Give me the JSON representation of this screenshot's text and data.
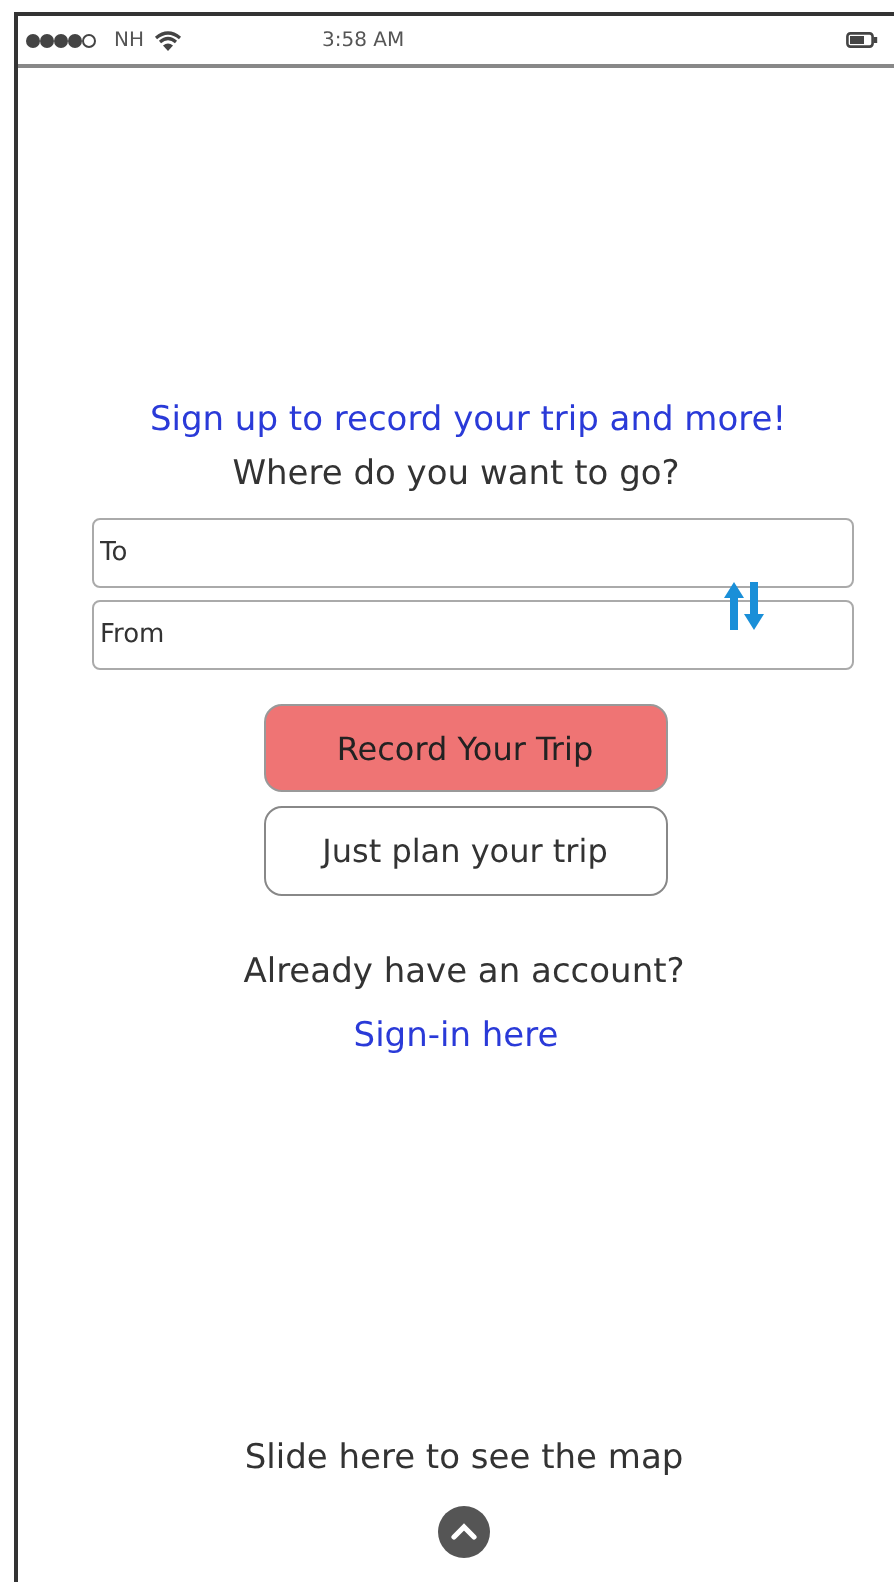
{
  "status_bar": {
    "carrier": "NH",
    "time": "3:58 AM"
  },
  "signup_prompt": "Sign up to record your trip and more!",
  "question": "Where do you want to go?",
  "fields": [
    {
      "placeholder": "To"
    },
    {
      "placeholder": "From"
    }
  ],
  "buttons": [
    {
      "label": "Record Your Trip",
      "kind": "primary"
    },
    {
      "label": "Just plan your trip",
      "kind": "secondary"
    }
  ],
  "account_prompt": "Already have an account?",
  "signin_link": "Sign-in here",
  "map_hint": "Slide here to see the map"
}
